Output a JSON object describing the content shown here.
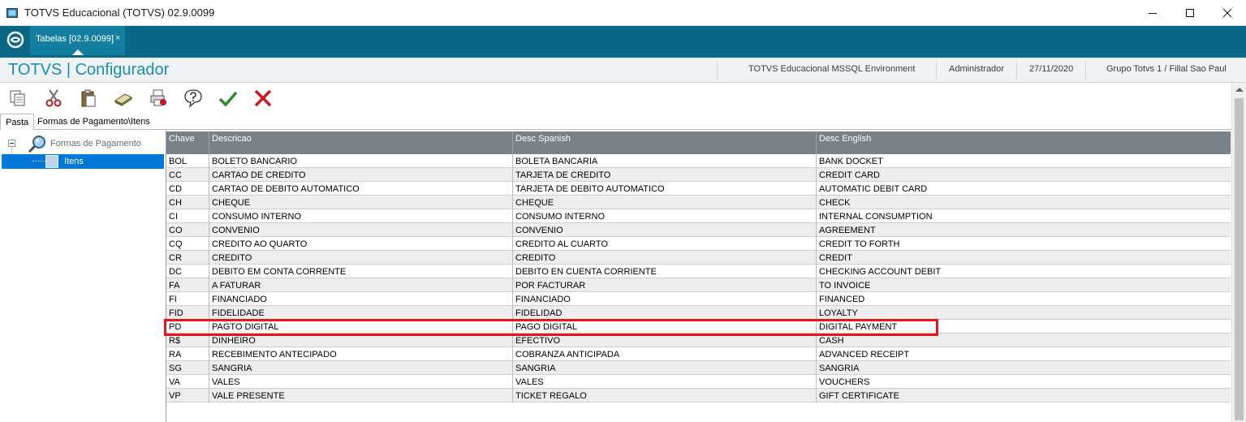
{
  "window": {
    "title": "TOTVS Educacional (TOTVS) 02.9.0099"
  },
  "tabstrip": {
    "tab_label": "Tabelas [02.9.0099]",
    "tab_close": "×"
  },
  "header": {
    "module_title": "TOTVS | Configurador",
    "environment": "TOTVS Educacional MSSQL Environment",
    "user": "Administrador",
    "date": "27/11/2020",
    "branch": "Grupo Totvs 1 / Filial Sao Paul"
  },
  "toolbar": {
    "icons": [
      "copy-icon",
      "cut-icon",
      "paste-icon",
      "eraser-icon",
      "print-icon",
      "help-icon",
      "confirm-icon",
      "cancel-icon"
    ]
  },
  "folder_tabs": [
    "Pasta",
    "Formas de Pagamento\\Itens"
  ],
  "tree": {
    "root_label": "Formas de Pagamento",
    "child_label": "Itens"
  },
  "grid": {
    "columns": [
      "Chave",
      "Descricao",
      "Desc Spanish",
      "Desc English"
    ],
    "rows": [
      [
        "BOL",
        "BOLETO BANCARIO",
        "BOLETA BANCARIA",
        "BANK DOCKET"
      ],
      [
        "CC",
        "CARTAO DE CREDITO",
        "TARJETA DE CREDITO",
        "CREDIT CARD"
      ],
      [
        "CD",
        "CARTAO DE DEBITO AUTOMATICO",
        "TARJETA DE DEBITO AUTOMATICO",
        "AUTOMATIC DEBIT CARD"
      ],
      [
        "CH",
        "CHEQUE",
        "CHEQUE",
        "CHECK"
      ],
      [
        "CI",
        "CONSUMO INTERNO",
        "CONSUMO INTERNO",
        "INTERNAL CONSUMPTION"
      ],
      [
        "CO",
        "CONVENIO",
        "CONVENIO",
        "AGREEMENT"
      ],
      [
        "CQ",
        "CREDITO AO QUARTO",
        "CREDITO AL CUARTO",
        "CREDIT TO FORTH"
      ],
      [
        "CR",
        "CREDITO",
        "CREDITO",
        "CREDIT"
      ],
      [
        "DC",
        "DEBITO EM CONTA CORRENTE",
        "DEBITO EN CUENTA CORRIENTE",
        "CHECKING ACCOUNT DEBIT"
      ],
      [
        "FA",
        "A FATURAR",
        "POR FACTURAR",
        "TO INVOICE"
      ],
      [
        "FI",
        "FINANCIADO",
        "FINANCIADO",
        "FINANCED"
      ],
      [
        "FID",
        "FIDELIDADE",
        "FIDELIDAD",
        "LOYALTY"
      ],
      [
        "PD",
        "PAGTO DIGITAL",
        "PAGO DIGITAL",
        "DIGITAL PAYMENT"
      ],
      [
        "R$",
        "DINHEIRO",
        "EFECTIVO",
        "CASH"
      ],
      [
        "RA",
        "RECEBIMENTO ANTECIPADO",
        "COBRANZA  ANTICIPADA",
        "ADVANCED RECEIPT"
      ],
      [
        "SG",
        "SANGRIA",
        "SANGRIA",
        "SANGRIA"
      ],
      [
        "VA",
        "VALES",
        "VALES",
        "VOUCHERS"
      ],
      [
        "VP",
        "VALE PRESENTE",
        "TICKET REGALO",
        "GIFT CERTIFICATE"
      ]
    ],
    "highlighted_row_key": "PD"
  },
  "colors": {
    "teal_bar": "#0a6785",
    "tab_active": "#137fa0",
    "title_blue": "#1a8fb5",
    "grid_header": "#78828b",
    "selection": "#0078d7",
    "highlight": "#e8141b"
  }
}
